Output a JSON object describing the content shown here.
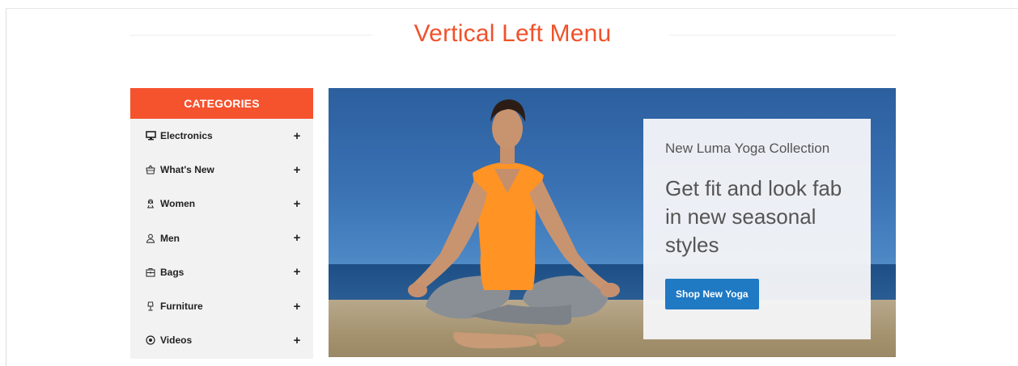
{
  "page": {
    "title": "Vertical Left Menu"
  },
  "sidebar": {
    "header": "CATEGORIES",
    "items": [
      {
        "label": "Electronics",
        "icon": "monitor-icon",
        "toggle": "+"
      },
      {
        "label": "What's New",
        "icon": "basket-icon",
        "toggle": "+"
      },
      {
        "label": "Women",
        "icon": "woman-icon",
        "toggle": "+"
      },
      {
        "label": "Men",
        "icon": "man-icon",
        "toggle": "+"
      },
      {
        "label": "Bags",
        "icon": "bag-icon",
        "toggle": "+"
      },
      {
        "label": "Furniture",
        "icon": "lamp-icon",
        "toggle": "+"
      },
      {
        "label": "Videos",
        "icon": "play-icon",
        "toggle": "+"
      }
    ]
  },
  "banner": {
    "subtitle": "New Luma Yoga Collection",
    "headline": "Get fit and look fab in new seasonal styles",
    "cta": "Shop New Yoga"
  },
  "colors": {
    "accent": "#f5522e",
    "title": "#f0522b",
    "button": "#1f79c3"
  }
}
